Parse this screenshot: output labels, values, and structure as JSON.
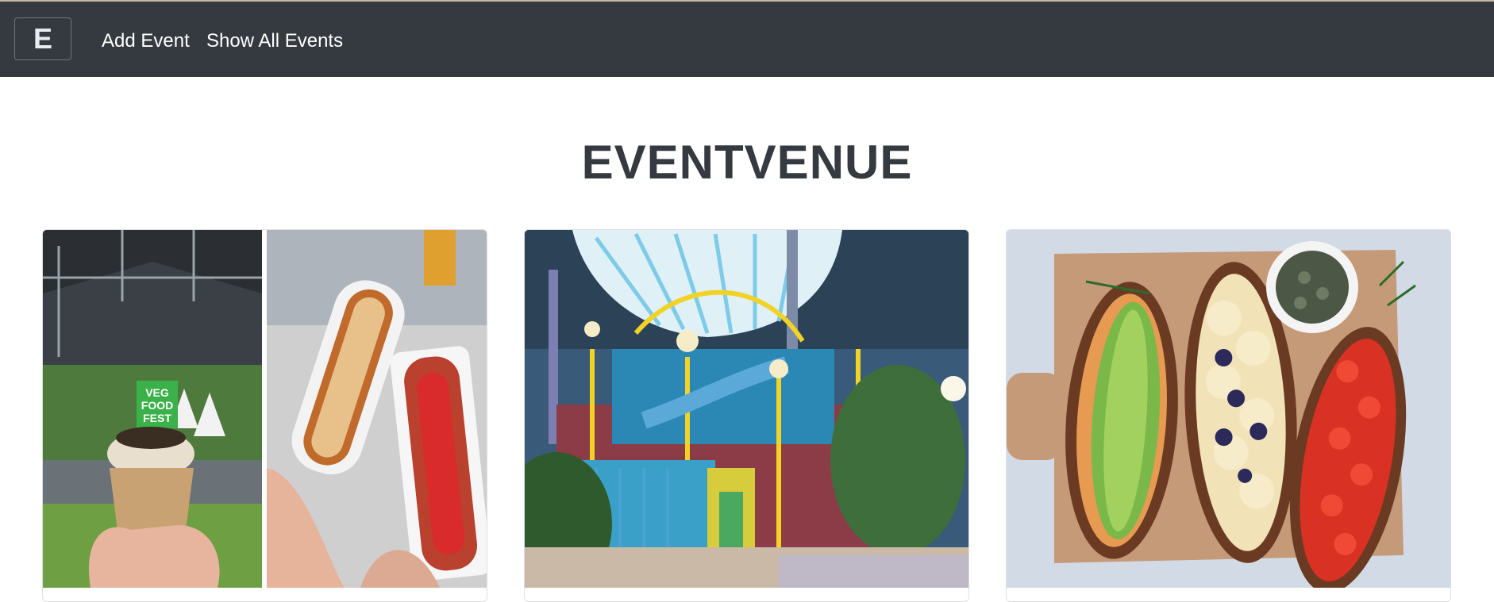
{
  "navbar": {
    "brand_letter": "E",
    "links": [
      "Add Event",
      "Show All Events"
    ]
  },
  "page": {
    "title": "EVENTVENUE"
  },
  "cards": [
    {
      "image_alt": "Veg Food Fest",
      "sign_text": "VEG FOOD FEST"
    },
    {
      "image_alt": "Indoor water park"
    },
    {
      "image_alt": "Toast on cutting board"
    }
  ],
  "colors": {
    "navbar_bg": "#343a40",
    "title": "#343a40",
    "nav_text": "#ffffff",
    "card_border": "#dfdfdf"
  }
}
